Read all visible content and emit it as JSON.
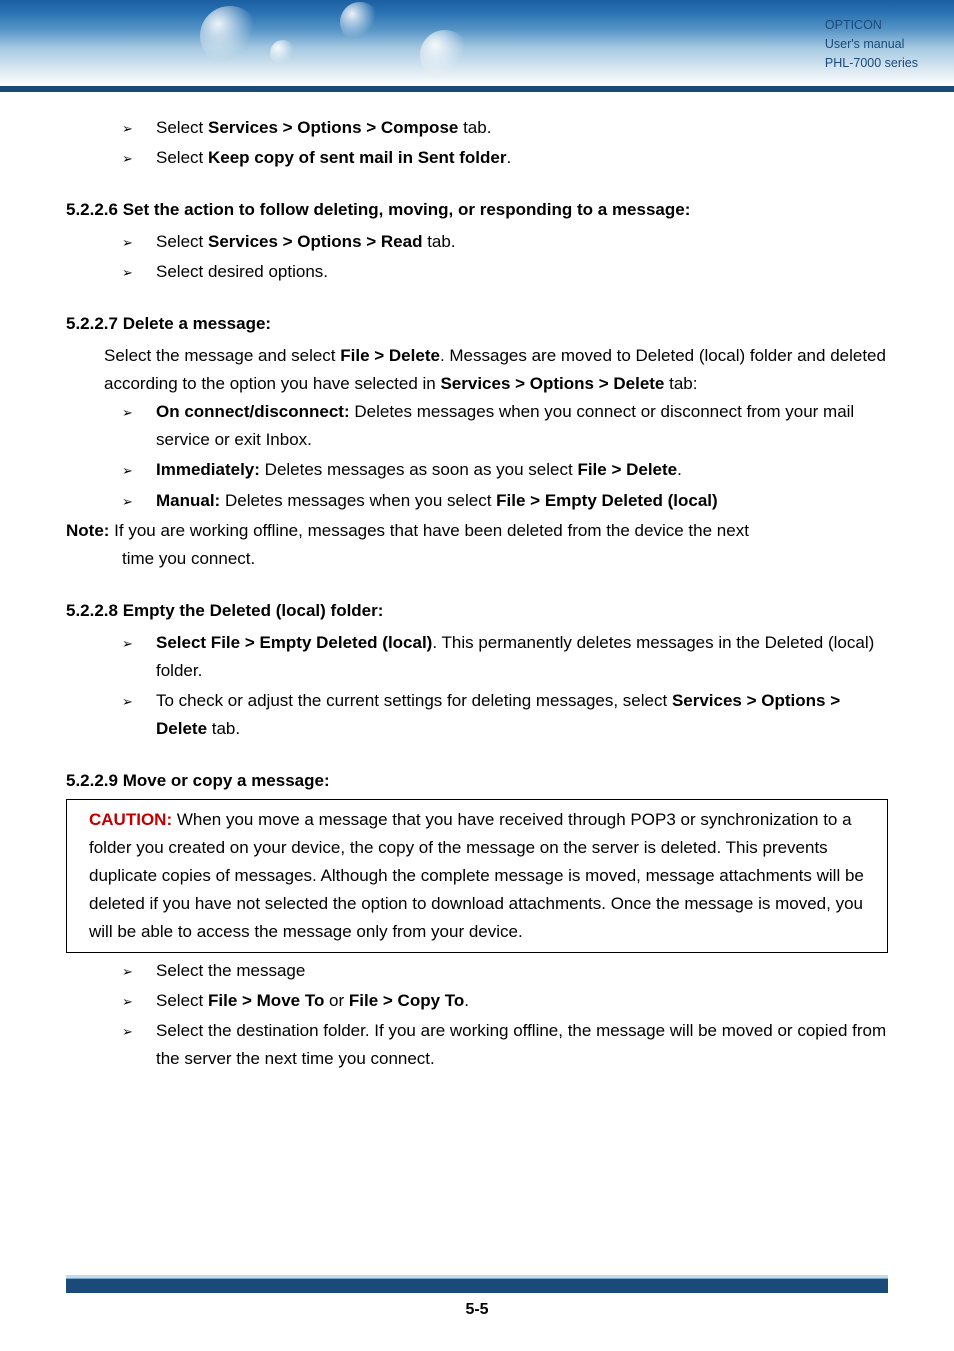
{
  "header": {
    "brand": "OPTICON",
    "line2": "User's manual",
    "line3": "PHL-7000 series"
  },
  "intro_bullets": [
    {
      "prefix": "Select ",
      "bold": "Services > Options > Compose",
      "suffix": " tab."
    },
    {
      "prefix": "Select ",
      "bold": "Keep copy of sent mail in Sent folder",
      "suffix": "."
    }
  ],
  "sec_5226": {
    "heading": "5.2.2.6 Set the action to follow deleting, moving, or responding to a message:",
    "bullets": [
      {
        "prefix": "Select ",
        "bold": "Services > Options > Read",
        "suffix": " tab."
      },
      {
        "prefix": "Select desired options.",
        "bold": "",
        "suffix": ""
      }
    ]
  },
  "sec_5227": {
    "heading": "5.2.2.7 Delete a message:",
    "para_pre": "Select the message and select ",
    "para_bold1": "File > Delete",
    "para_mid": ". Messages are moved to Deleted (local) folder and deleted according to the option you have selected in ",
    "para_bold2": "Services > Options > Delete",
    "para_suf": " tab:",
    "bullets": [
      {
        "lead_bold": "On connect/disconnect:",
        "rest": " Deletes messages when you connect or disconnect from your mail service or exit Inbox."
      },
      {
        "lead_bold": "Immediately:",
        "rest_pre": " Deletes messages as soon as you select ",
        "rest_bold": "File > Delete",
        "rest_suf": "."
      },
      {
        "lead_bold": "Manual:",
        "rest_pre": " Deletes messages when you select ",
        "rest_bold": "File > Empty Deleted (local)",
        "rest_suf": ""
      }
    ],
    "note_label": "Note:",
    "note_text": " If you are working offline, messages that have been deleted from the device the next ",
    "note_line2": "time you connect."
  },
  "sec_5228": {
    "heading": "5.2.2.8 Empty the Deleted (local) folder:",
    "bullets": [
      {
        "lead_bold": "Select File > Empty Deleted (local)",
        "rest": ". This permanently deletes messages in the Deleted (local) folder."
      },
      {
        "pre": "To check or adjust the current settings for deleting messages, select ",
        "bold1": "Services > Options > Delete",
        "suf": " tab."
      }
    ]
  },
  "sec_5229": {
    "heading": "5.2.2.9 Move or copy a message:",
    "caution_label": "CAUTION:",
    "caution_text": " When you move a message that you have received through POP3 or synchronization to a folder you created on your device, the copy of the message on the server is deleted. This prevents duplicate copies of messages. Although the complete message is moved, message attachments will be deleted if you have not selected the option to download attachments. Once the message is moved, you will be able to access the message only from your device.",
    "bullets": [
      {
        "text": "Select the message"
      },
      {
        "pre": "Select ",
        "bold1": "File > Move To",
        "mid": " or ",
        "bold2": "File > Copy To",
        "suf": "."
      },
      {
        "text": "Select the destination folder. If you are working offline, the message will be moved or copied from the server the next time you connect."
      }
    ]
  },
  "page_number": "5-5"
}
